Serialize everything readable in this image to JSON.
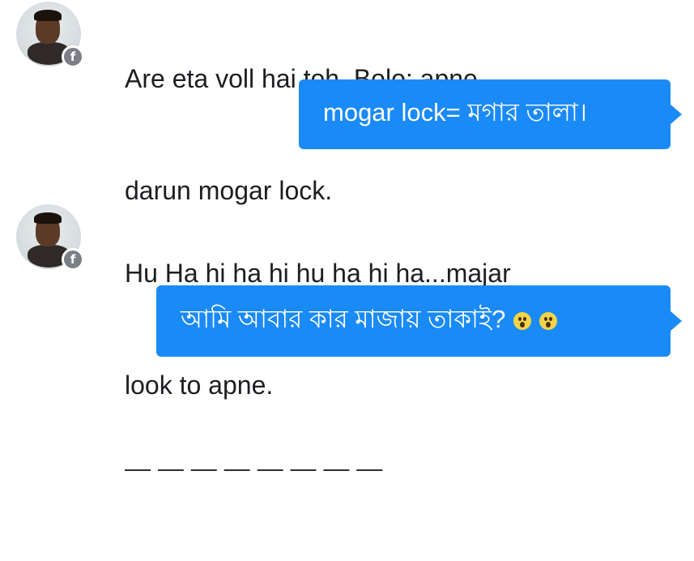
{
  "messages": [
    {
      "direction": "incoming",
      "lines": [
        "Are eta voll hai toh. Bolo: apne",
        "darun mogar lock."
      ]
    },
    {
      "direction": "outgoing",
      "text": "mogar lock= মগার তালা।"
    },
    {
      "direction": "incoming",
      "lines": [
        "Hu Ha hi ha hi hu ha hi ha...majar",
        "look to apne."
      ]
    },
    {
      "direction": "outgoing",
      "text": "আমি আবার কার মাজায় তাকাই?",
      "emojis": [
        "astonished-face-icon",
        "astonished-face-icon"
      ]
    },
    {
      "direction": "incoming",
      "lines": [
        "— — — — — — — —"
      ]
    }
  ],
  "avatar": {
    "badge_glyph": "f",
    "badge_icon": "facebook-badge-icon"
  },
  "colors": {
    "bubble": "#1a8af7",
    "bubble_text": "#ffffff",
    "incoming_text": "#1c1e21",
    "background": "#ffffff"
  }
}
